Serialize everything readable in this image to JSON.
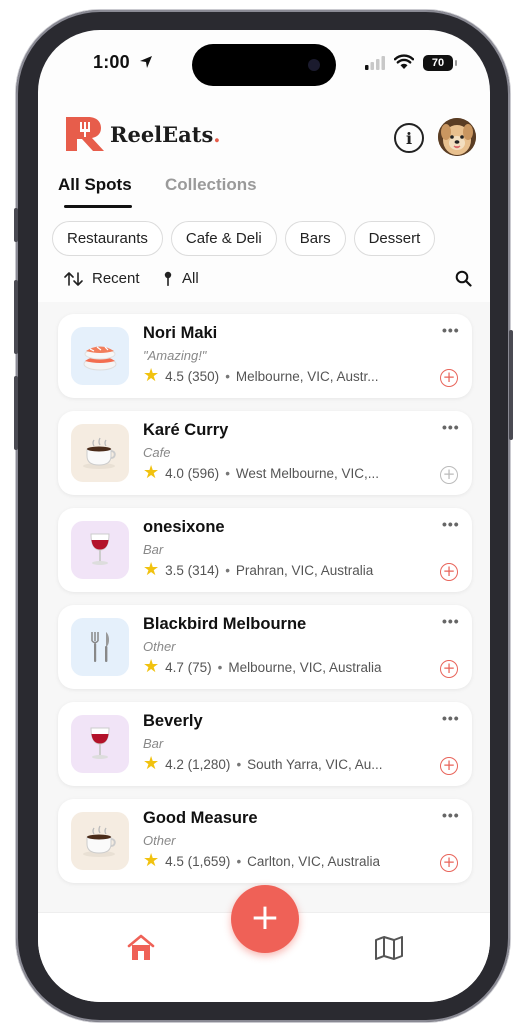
{
  "status_bar": {
    "time": "1:00",
    "battery": "70"
  },
  "header": {
    "brand": "ReelEats",
    "brand_dot": "."
  },
  "tabs": [
    {
      "label": "All Spots",
      "active": true
    },
    {
      "label": "Collections",
      "active": false
    }
  ],
  "categories": [
    "Restaurants",
    "Cafe & Deli",
    "Bars",
    "Dessert"
  ],
  "filters": {
    "sort_label": "Recent",
    "location_label": "All"
  },
  "spots": [
    {
      "name": "Nori Maki",
      "subtitle": "\"Amazing!\"",
      "rating": "4.5 (350)",
      "location": "Melbourne, VIC, Austr...",
      "icon": "sushi-icon",
      "saved": true
    },
    {
      "name": "Karé Curry",
      "subtitle": "Cafe",
      "rating": "4.0 (596)",
      "location": "West Melbourne, VIC,...",
      "icon": "coffee-icon",
      "saved": false
    },
    {
      "name": "onesixone",
      "subtitle": "Bar",
      "rating": "3.5 (314)",
      "location": "Prahran, VIC, Australia",
      "icon": "wine-glass-icon",
      "saved": true
    },
    {
      "name": "Blackbird Melbourne",
      "subtitle": "Other",
      "rating": "4.7 (75)",
      "location": "Melbourne, VIC, Australia",
      "icon": "cutlery-icon",
      "saved": true
    },
    {
      "name": "Beverly",
      "subtitle": "Bar",
      "rating": "4.2 (1,280)",
      "location": "South Yarra, VIC, Au...",
      "icon": "wine-glass-icon",
      "saved": true
    },
    {
      "name": "Good Measure",
      "subtitle": "Other",
      "rating": "4.5 (1,659)",
      "location": "Carlton, VIC, Australia",
      "icon": "coffee-icon",
      "saved": true
    }
  ],
  "colors": {
    "accent": "#ef6157",
    "star": "#f1c20f"
  }
}
